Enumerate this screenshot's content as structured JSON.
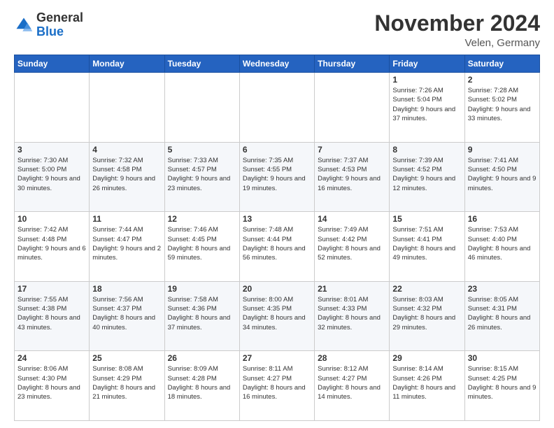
{
  "logo": {
    "text_general": "General",
    "text_blue": "Blue"
  },
  "header": {
    "month": "November 2024",
    "location": "Velen, Germany"
  },
  "weekdays": [
    "Sunday",
    "Monday",
    "Tuesday",
    "Wednesday",
    "Thursday",
    "Friday",
    "Saturday"
  ],
  "weeks": [
    [
      {
        "day": "",
        "info": ""
      },
      {
        "day": "",
        "info": ""
      },
      {
        "day": "",
        "info": ""
      },
      {
        "day": "",
        "info": ""
      },
      {
        "day": "",
        "info": ""
      },
      {
        "day": "1",
        "info": "Sunrise: 7:26 AM\nSunset: 5:04 PM\nDaylight: 9 hours and 37 minutes."
      },
      {
        "day": "2",
        "info": "Sunrise: 7:28 AM\nSunset: 5:02 PM\nDaylight: 9 hours and 33 minutes."
      }
    ],
    [
      {
        "day": "3",
        "info": "Sunrise: 7:30 AM\nSunset: 5:00 PM\nDaylight: 9 hours and 30 minutes."
      },
      {
        "day": "4",
        "info": "Sunrise: 7:32 AM\nSunset: 4:58 PM\nDaylight: 9 hours and 26 minutes."
      },
      {
        "day": "5",
        "info": "Sunrise: 7:33 AM\nSunset: 4:57 PM\nDaylight: 9 hours and 23 minutes."
      },
      {
        "day": "6",
        "info": "Sunrise: 7:35 AM\nSunset: 4:55 PM\nDaylight: 9 hours and 19 minutes."
      },
      {
        "day": "7",
        "info": "Sunrise: 7:37 AM\nSunset: 4:53 PM\nDaylight: 9 hours and 16 minutes."
      },
      {
        "day": "8",
        "info": "Sunrise: 7:39 AM\nSunset: 4:52 PM\nDaylight: 9 hours and 12 minutes."
      },
      {
        "day": "9",
        "info": "Sunrise: 7:41 AM\nSunset: 4:50 PM\nDaylight: 9 hours and 9 minutes."
      }
    ],
    [
      {
        "day": "10",
        "info": "Sunrise: 7:42 AM\nSunset: 4:48 PM\nDaylight: 9 hours and 6 minutes."
      },
      {
        "day": "11",
        "info": "Sunrise: 7:44 AM\nSunset: 4:47 PM\nDaylight: 9 hours and 2 minutes."
      },
      {
        "day": "12",
        "info": "Sunrise: 7:46 AM\nSunset: 4:45 PM\nDaylight: 8 hours and 59 minutes."
      },
      {
        "day": "13",
        "info": "Sunrise: 7:48 AM\nSunset: 4:44 PM\nDaylight: 8 hours and 56 minutes."
      },
      {
        "day": "14",
        "info": "Sunrise: 7:49 AM\nSunset: 4:42 PM\nDaylight: 8 hours and 52 minutes."
      },
      {
        "day": "15",
        "info": "Sunrise: 7:51 AM\nSunset: 4:41 PM\nDaylight: 8 hours and 49 minutes."
      },
      {
        "day": "16",
        "info": "Sunrise: 7:53 AM\nSunset: 4:40 PM\nDaylight: 8 hours and 46 minutes."
      }
    ],
    [
      {
        "day": "17",
        "info": "Sunrise: 7:55 AM\nSunset: 4:38 PM\nDaylight: 8 hours and 43 minutes."
      },
      {
        "day": "18",
        "info": "Sunrise: 7:56 AM\nSunset: 4:37 PM\nDaylight: 8 hours and 40 minutes."
      },
      {
        "day": "19",
        "info": "Sunrise: 7:58 AM\nSunset: 4:36 PM\nDaylight: 8 hours and 37 minutes."
      },
      {
        "day": "20",
        "info": "Sunrise: 8:00 AM\nSunset: 4:35 PM\nDaylight: 8 hours and 34 minutes."
      },
      {
        "day": "21",
        "info": "Sunrise: 8:01 AM\nSunset: 4:33 PM\nDaylight: 8 hours and 32 minutes."
      },
      {
        "day": "22",
        "info": "Sunrise: 8:03 AM\nSunset: 4:32 PM\nDaylight: 8 hours and 29 minutes."
      },
      {
        "day": "23",
        "info": "Sunrise: 8:05 AM\nSunset: 4:31 PM\nDaylight: 8 hours and 26 minutes."
      }
    ],
    [
      {
        "day": "24",
        "info": "Sunrise: 8:06 AM\nSunset: 4:30 PM\nDaylight: 8 hours and 23 minutes."
      },
      {
        "day": "25",
        "info": "Sunrise: 8:08 AM\nSunset: 4:29 PM\nDaylight: 8 hours and 21 minutes."
      },
      {
        "day": "26",
        "info": "Sunrise: 8:09 AM\nSunset: 4:28 PM\nDaylight: 8 hours and 18 minutes."
      },
      {
        "day": "27",
        "info": "Sunrise: 8:11 AM\nSunset: 4:27 PM\nDaylight: 8 hours and 16 minutes."
      },
      {
        "day": "28",
        "info": "Sunrise: 8:12 AM\nSunset: 4:27 PM\nDaylight: 8 hours and 14 minutes."
      },
      {
        "day": "29",
        "info": "Sunrise: 8:14 AM\nSunset: 4:26 PM\nDaylight: 8 hours and 11 minutes."
      },
      {
        "day": "30",
        "info": "Sunrise: 8:15 AM\nSunset: 4:25 PM\nDaylight: 8 hours and 9 minutes."
      }
    ]
  ]
}
